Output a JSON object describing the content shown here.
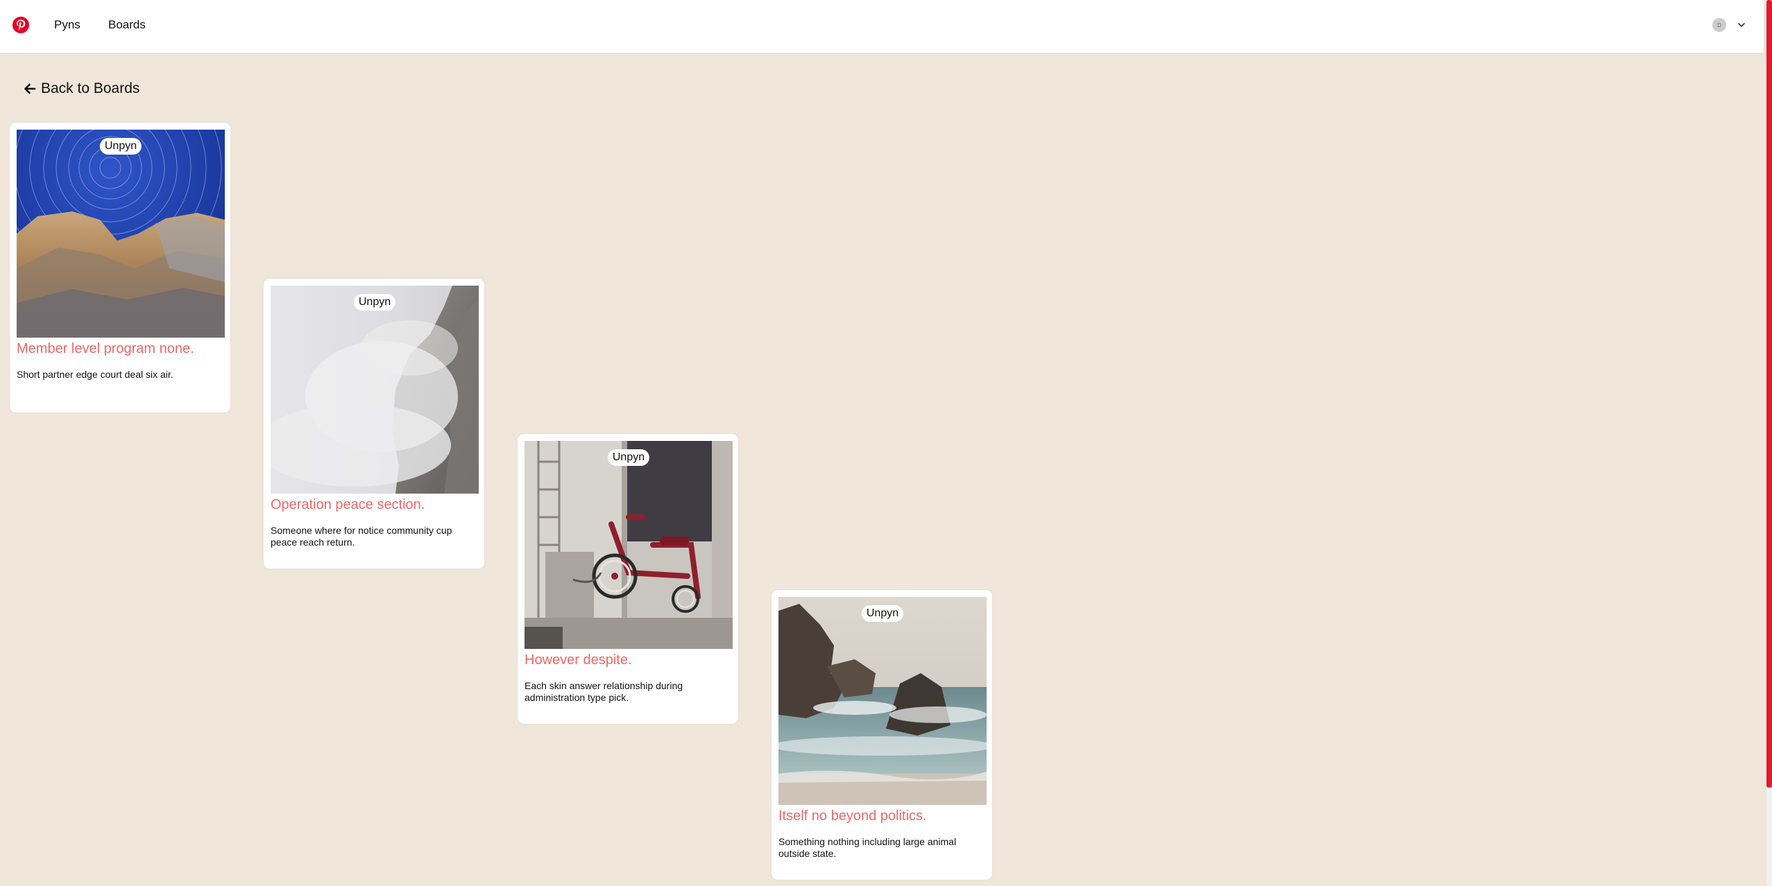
{
  "header": {
    "nav": [
      {
        "label": "Pyns"
      },
      {
        "label": "Boards"
      }
    ],
    "avatar_initial": "D"
  },
  "back_label": "Back to Boards",
  "colors": {
    "brand": "#e60023",
    "background": "#f0e6da",
    "title": "#ee6868"
  },
  "cards": [
    {
      "unpyn_label": "Unpyn",
      "title": "Member level program none.",
      "description": "Short partner edge court deal six air."
    },
    {
      "unpyn_label": "Unpyn",
      "title": "Operation peace section.",
      "description": "Someone where for notice community cup peace reach return."
    },
    {
      "unpyn_label": "Unpyn",
      "title": "However despite.",
      "description": "Each skin answer relationship during administration type pick."
    },
    {
      "unpyn_label": "Unpyn",
      "title": "Itself no beyond politics.",
      "description": "Something nothing including large animal outside state."
    }
  ]
}
